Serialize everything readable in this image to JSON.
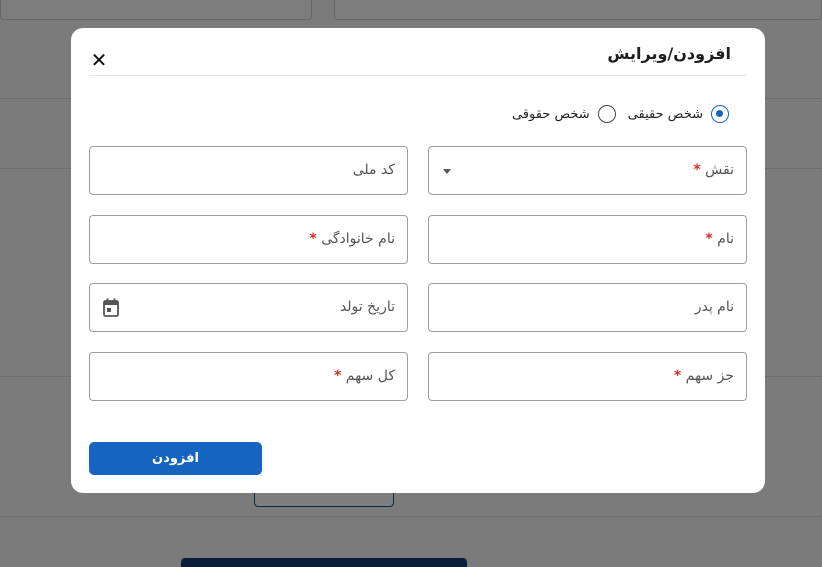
{
  "modal": {
    "title": "افزودن/ویرایش",
    "close_icon": "✕"
  },
  "person_type": {
    "options": [
      {
        "label": "شخص حقیقی",
        "checked": true
      },
      {
        "label": "شخص حقوقی",
        "checked": false
      }
    ]
  },
  "fields": {
    "role": {
      "label": "نقش",
      "required": true,
      "icon": "chevron-down-icon"
    },
    "national_code": {
      "label": "کد ملی",
      "required": false
    },
    "first_name": {
      "label": "نام",
      "required": true
    },
    "last_name": {
      "label": "نام خانوادگی",
      "required": true
    },
    "father_name": {
      "label": "نام پدر",
      "required": false
    },
    "birth_date": {
      "label": "تاریخ تولد",
      "required": false,
      "icon": "calendar-icon"
    },
    "partial_share": {
      "label": "جز سهم",
      "required": true
    },
    "total_share": {
      "label": "کل سهم",
      "required": true
    }
  },
  "required_mark": "*",
  "submit": {
    "label": "افزودن"
  },
  "colors": {
    "accent": "#1565c0",
    "required": "#d32f2f",
    "overlay": "rgba(0,0,0,0.5)"
  }
}
